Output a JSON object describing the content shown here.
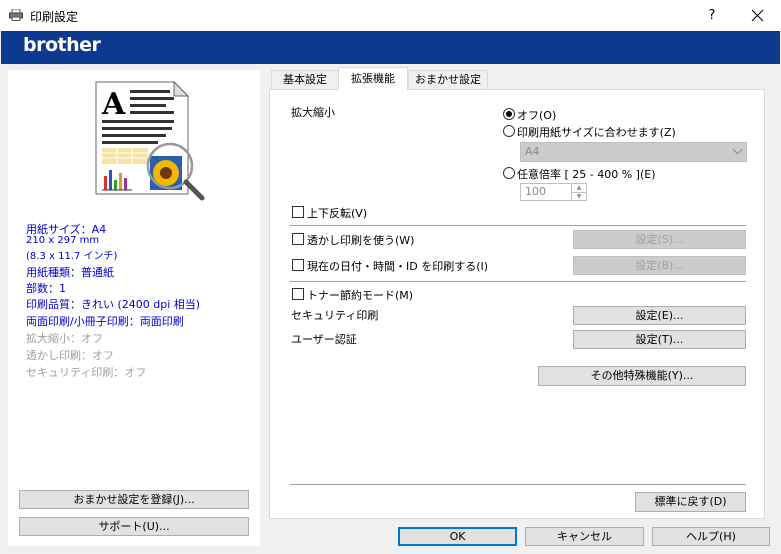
{
  "window": {
    "title": "印刷設定",
    "help": "?",
    "brand": "brother"
  },
  "summary": {
    "paper_size": "用紙サイズ：A4",
    "paper_dim1": "210 x 297 mm",
    "paper_dim2": "(8.3 x 11.7 インチ)",
    "media_type": "用紙種類：普通紙",
    "copies": "部数：1",
    "quality": "印刷品質：きれい (2400 dpi 相当)",
    "duplex": "両面印刷/小冊子印刷：両面印刷",
    "scaling": "拡大縮小：オフ",
    "watermark": "透かし印刷：オフ",
    "secure": "セキュリティ印刷：オフ"
  },
  "left_buttons": {
    "register": "おまかせ設定を登録(J)...",
    "support": "サポート(U)..."
  },
  "tabs": [
    {
      "label": "基本設定",
      "active": false
    },
    {
      "label": "拡張機能",
      "active": true
    },
    {
      "label": "おまかせ設定",
      "active": false
    }
  ],
  "scaling": {
    "label": "拡大縮小",
    "off": "オフ(O)",
    "fit": "印刷用紙サイズに合わせます(Z)",
    "fit_paper": "A4",
    "free": "任意倍率 [ 25 - 400 % ](E)",
    "free_value": "100",
    "selected": "off"
  },
  "options": {
    "mirror": "上下反転(V)",
    "watermark": "透かし印刷を使う(W)",
    "header_footer": "現在の日付・時間・ID を印刷する(I)",
    "toner_save": "トナー節約モード(M)",
    "secure_label": "セキュリティ印刷",
    "auth_label": "ユーザー認証"
  },
  "buttons": {
    "watermark_settings": "設定(S)...",
    "header_settings": "設定(B)...",
    "secure_settings": "設定(E)...",
    "auth_settings": "設定(T)...",
    "other": "その他特殊機能(Y)...",
    "default": "標準に戻す(D)",
    "ok": "OK",
    "cancel": "キャンセル",
    "help": "ヘルプ(H)"
  }
}
